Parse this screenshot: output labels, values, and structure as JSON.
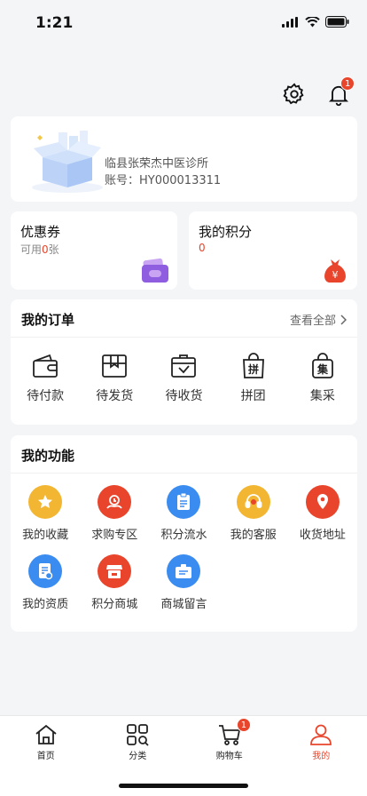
{
  "status": {
    "time": "1:21"
  },
  "header": {
    "notification_count": "1"
  },
  "profile": {
    "name": "临县张荣杰中医诊所",
    "account": "账号：HY000013311"
  },
  "coupon": {
    "title": "优惠券",
    "prefix": "可用",
    "count": "0",
    "suffix": "张"
  },
  "points": {
    "title": "我的积分",
    "value": "0"
  },
  "orders": {
    "title": "我的订单",
    "view_all": "查看全部",
    "items": [
      {
        "label": "待付款",
        "icon": "wallet-icon"
      },
      {
        "label": "待发货",
        "icon": "box-icon"
      },
      {
        "label": "待收货",
        "icon": "package-receive-icon"
      },
      {
        "label": "拼团",
        "icon": "group-buy-bag-icon"
      },
      {
        "label": "集采",
        "icon": "bulk-purchase-bag-icon"
      }
    ]
  },
  "features": {
    "title": "我的功能",
    "items": [
      {
        "label": "我的收藏",
        "icon": "star-icon",
        "color": "#f2b632"
      },
      {
        "label": "求购专区",
        "icon": "request-icon",
        "color": "#e8452c"
      },
      {
        "label": "积分流水",
        "icon": "clipboard-icon",
        "color": "#3b8cf0"
      },
      {
        "label": "我的客服",
        "icon": "headset-icon",
        "color": "#f2b632"
      },
      {
        "label": "收货地址",
        "icon": "location-pin-icon",
        "color": "#e8452c"
      },
      {
        "label": "我的资质",
        "icon": "certificate-icon",
        "color": "#3b8cf0"
      },
      {
        "label": "积分商城",
        "icon": "store-icon",
        "color": "#e8452c"
      },
      {
        "label": "商城留言",
        "icon": "message-board-icon",
        "color": "#3b8cf0"
      }
    ]
  },
  "tabs": {
    "items": [
      {
        "label": "首页",
        "icon": "home-icon"
      },
      {
        "label": "分类",
        "icon": "category-icon"
      },
      {
        "label": "购物车",
        "icon": "cart-icon",
        "badge": "1"
      },
      {
        "label": "我的",
        "icon": "user-icon",
        "active": true
      }
    ]
  },
  "colors": {
    "accent": "#e8452c",
    "blue": "#3b8cf0",
    "yellow": "#f2b632",
    "background": "#f4f5f7"
  }
}
